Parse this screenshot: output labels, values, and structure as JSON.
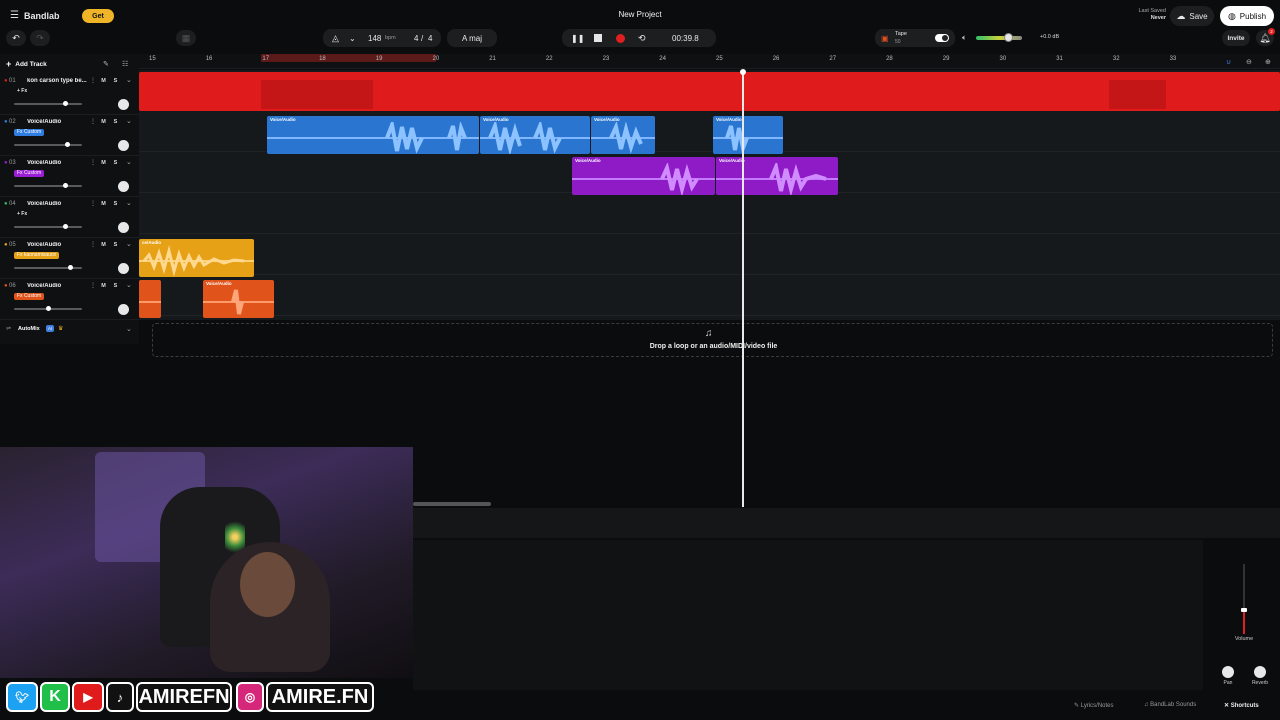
{
  "topbar": {
    "app_brand": "Bandlab",
    "get_label": "Get",
    "project_title": "New Project",
    "tempo": "148",
    "tempo_unit": "bpm",
    "time_sig_num": "4",
    "time_sig_sep": "/",
    "time_sig_den": "4",
    "key": "A maj",
    "time": "00:39.8",
    "tape_label": "Tape",
    "tape_value": "50",
    "volume_db": "+0.0 dB",
    "last_saved_label": "Last Saved",
    "last_saved_value": "Never",
    "save_label": "Save",
    "publish_label": "Publish",
    "invite_label": "Invite",
    "notif_count": "2"
  },
  "sidebar": {
    "add_track": "Add Track",
    "automix": "AutoMix",
    "ai_badge": "AI",
    "tracks": [
      {
        "num": "01",
        "name": "kon carson type be...",
        "fx": "+ Fx",
        "fx_color": "",
        "mute": "M",
        "solo": "S",
        "vol": 0.75
      },
      {
        "num": "02",
        "name": "Voice/Audio",
        "fx": "Fx Custom",
        "fx_color": "#2f7de0",
        "mute": "M",
        "solo": "S",
        "vol": 0.78
      },
      {
        "num": "03",
        "name": "Voice/Audio",
        "fx": "Fx Custom",
        "fx_color": "#9b1fd6",
        "mute": "M",
        "solo": "S",
        "vol": 0.75
      },
      {
        "num": "04",
        "name": "Voice/Audio",
        "fx": "+ Fx",
        "fx_color": "",
        "mute": "M",
        "solo": "S",
        "vol": 0.75
      },
      {
        "num": "05",
        "name": "Voice/Audio",
        "fx": "Fx kaonamisauce",
        "fx_color": "#e6a117",
        "mute": "M",
        "solo": "S",
        "vol": 0.83
      },
      {
        "num": "06",
        "name": "Voice/Audio",
        "fx": "Fx Custom",
        "fx_color": "#e0541b",
        "mute": "M",
        "solo": "S",
        "vol": 0.5
      }
    ]
  },
  "ruler": [
    "15",
    "16",
    "17",
    "18",
    "19",
    "20",
    "21",
    "22",
    "23",
    "24",
    "25",
    "26",
    "27",
    "28",
    "29",
    "30",
    "31",
    "32",
    "33"
  ],
  "regions": {
    "label": "Voice/Audio",
    "label_partial": "ce/Audio"
  },
  "dropzone": {
    "text": "Drop a loop or an audio/MIDI/video file"
  },
  "mixer": {
    "volume_label": "Volume",
    "pan_label": "Pan",
    "reverb_label": "Reverb"
  },
  "statusbar": {
    "lyrics": "Lyrics/Notes",
    "sounds": "BandLab Sounds",
    "shortcuts": "Shortcuts"
  },
  "social": {
    "handle1": "AMIREFN",
    "handle2": "AMIRE.FN"
  },
  "colors": {
    "track1": "#e01b1b",
    "track2": "#2f7de0",
    "track3": "#9b1fd6",
    "track5": "#e6a117",
    "track6": "#e0541b",
    "record": "#e02020"
  }
}
